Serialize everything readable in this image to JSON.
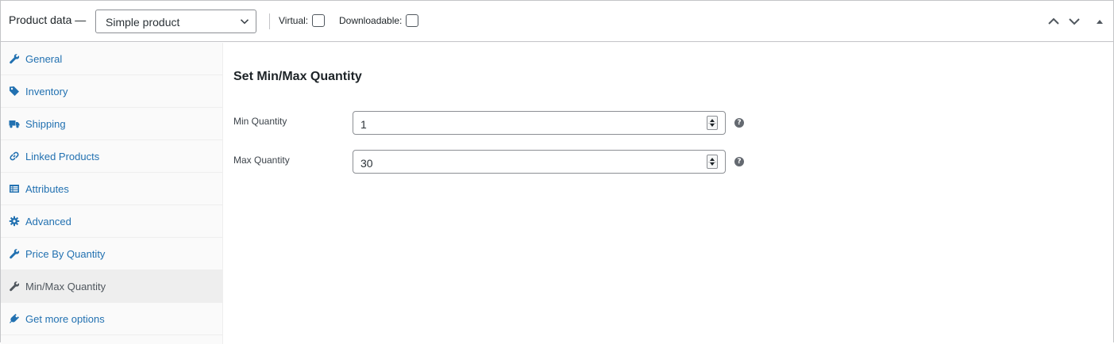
{
  "header": {
    "title": "Product data —",
    "product_type": "Simple product",
    "virtual_label": "Virtual:",
    "downloadable_label": "Downloadable:",
    "virtual_checked": false,
    "downloadable_checked": false
  },
  "sidebar": {
    "items": [
      {
        "label": "General",
        "icon": "wrench-icon"
      },
      {
        "label": "Inventory",
        "icon": "tag-icon"
      },
      {
        "label": "Shipping",
        "icon": "truck-icon"
      },
      {
        "label": "Linked Products",
        "icon": "link-icon"
      },
      {
        "label": "Attributes",
        "icon": "list-icon"
      },
      {
        "label": "Advanced",
        "icon": "gear-icon"
      },
      {
        "label": "Price By Quantity",
        "icon": "wrench-icon"
      },
      {
        "label": "Min/Max Quantity",
        "icon": "wrench-icon",
        "active": true
      },
      {
        "label": "Get more options",
        "icon": "plugin-icon"
      }
    ]
  },
  "main": {
    "section_title": "Set Min/Max Quantity",
    "fields": [
      {
        "label": "Min Quantity",
        "value": "1",
        "help": "?"
      },
      {
        "label": "Max Quantity",
        "value": "30",
        "help": "?"
      }
    ]
  },
  "colors": {
    "link": "#2271b1",
    "active_tab_bg": "#eeeeee",
    "sidebar_bg": "#fafafa",
    "border": "#c3c4c7"
  }
}
